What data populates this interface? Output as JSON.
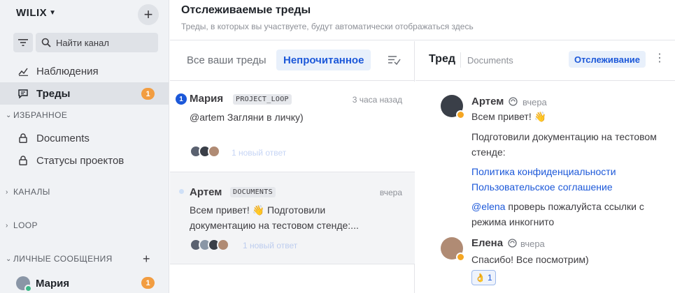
{
  "sidebar": {
    "workspace": "WILIX",
    "search_placeholder": "Найти канал",
    "nav": [
      {
        "label": "Наблюдения"
      },
      {
        "label": "Треды",
        "badge": "1"
      }
    ],
    "favorites_label": "ИЗБРАННОЕ",
    "favorites": [
      {
        "label": "Documents"
      },
      {
        "label": "Статусы проектов"
      }
    ],
    "channels_label": "КАНАЛЫ",
    "loop_label": "LOOP",
    "dm_label": "ЛИЧНЫЕ СООБЩЕНИЯ",
    "dm": {
      "name": "Мария",
      "badge": "1"
    }
  },
  "header": {
    "title": "Отслеживаемые треды",
    "subtitle": "Треды, в которых вы участвуете, будут автоматически отображаться здесь"
  },
  "list": {
    "tabs": [
      "Все ваши треды",
      "Непрочитанное"
    ],
    "threads": [
      {
        "unread": "1",
        "author": "Мария",
        "channel": "PROJECT_LOOP",
        "time": "3 часа назад",
        "text_line1": "@artem  Загляни в личку)",
        "new_reply": "1 новый ответ"
      },
      {
        "author": "Артем",
        "channel": "DOCUMENTS",
        "time": "вчера",
        "text_line1": "Всем привет! 👋  Подготовили",
        "text_line2": "документацию на тестовом стенде:...",
        "new_reply": "1 новый ответ"
      }
    ]
  },
  "view": {
    "title": "Тред",
    "channel": "Documents",
    "follow_label": "Отслеживание",
    "post1": {
      "author": "Артем",
      "time": "вчера",
      "greeting": "Всем привет! 👋",
      "line1": "Подготовили документацию на тестовом",
      "line2": "стенде:",
      "link1": "Политика конфиденциальности",
      "link2": "Пользовательское соглашение",
      "mention": "@elena",
      "mention_rest": " проверь пожалуйста ссылки с",
      "line3": "режима инкогнито"
    },
    "post2": {
      "author": "Елена",
      "time": "вчера",
      "text": "Спасибо! Все посмотрим)",
      "reaction_emoji": "👌",
      "reaction_count": "1"
    }
  },
  "colors": {
    "accent": "#1c58d9",
    "badge": "#f29d41",
    "sidebar_bg": "#f0f2f5"
  }
}
